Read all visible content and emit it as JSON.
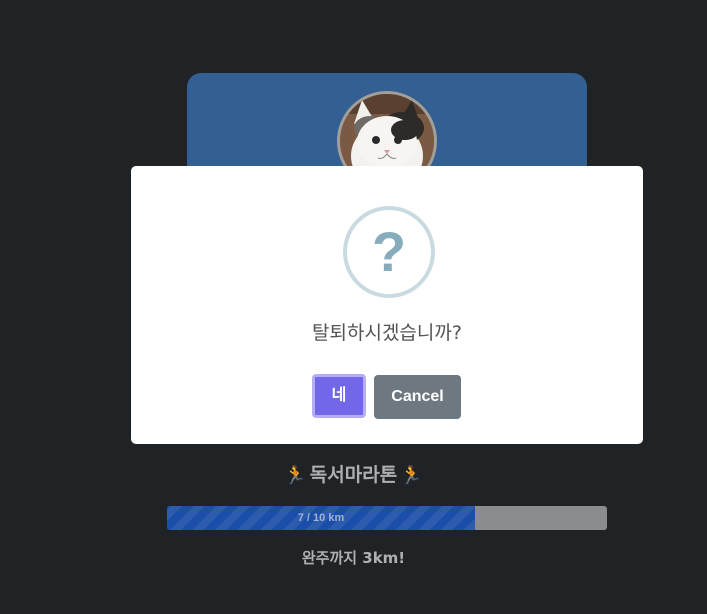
{
  "profile": {
    "avatar_alt": "cat-photo",
    "card_color": "#345f93"
  },
  "dialog": {
    "icon": "question-icon",
    "title": "탈퇴하시겠습니까?",
    "confirm_label": "네",
    "cancel_label": "Cancel",
    "confirm_color": "#7367e9",
    "cancel_color": "#6e7881"
  },
  "marathon": {
    "title": "독서마라톤",
    "title_icon": "runner-icon",
    "progress": {
      "current_km": 7,
      "total_km": 10,
      "fraction": 0.7,
      "label": "7 / 10 km"
    },
    "remaining_text": "완주까지 3km!"
  }
}
